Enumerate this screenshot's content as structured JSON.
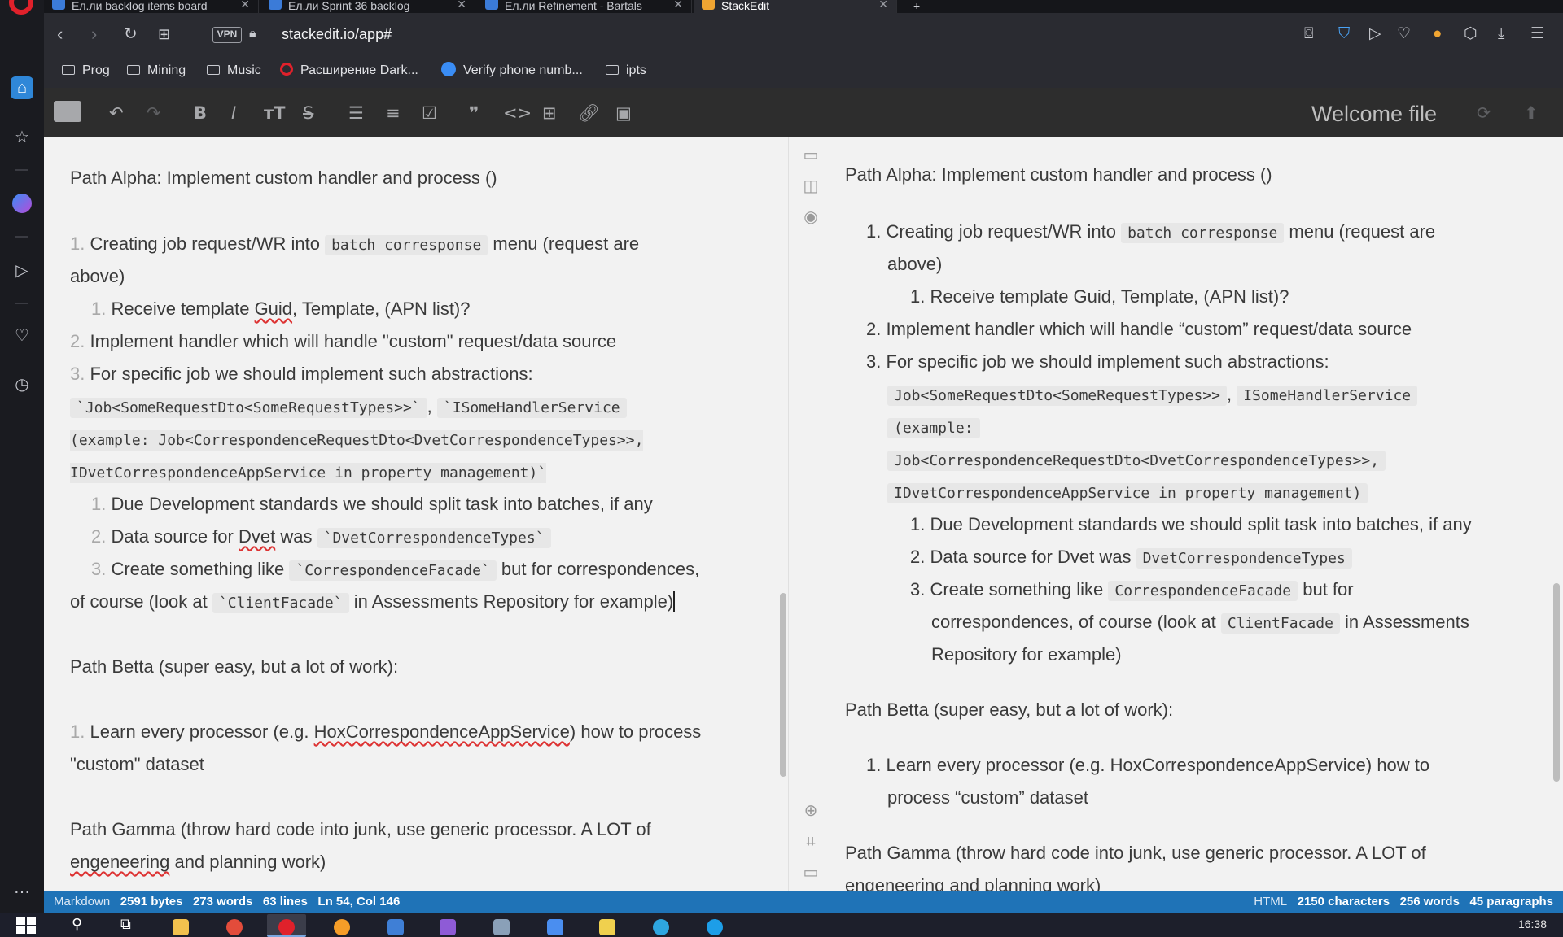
{
  "browser": {
    "tabs": [
      {
        "label": "Ел.ли backlog items board",
        "active": false
      },
      {
        "label": "Ел.ли Sprint 36 backlog",
        "active": false
      },
      {
        "label": "Ел.ли Refinement - Bartals",
        "active": false
      },
      {
        "label": "StackEdit",
        "active": true
      }
    ],
    "vpn_label": "VPN",
    "url": "stackedit.io/app#",
    "bookmarks": [
      "Prog",
      "Mining",
      "Music",
      "Расширение Dark...",
      "Verify phone numb...",
      "ipts"
    ]
  },
  "stackedit": {
    "file_title": "Welcome file",
    "workspace_button": "#"
  },
  "editor": {
    "l1": "Path Alpha: Implement custom handler and process ()",
    "l2_num": "1.",
    "l2_a": " Creating job request/WR into ",
    "l2_code": "batch corresponse",
    "l2_b": " menu (request are",
    "l3": "above)",
    "l4_num": "1.",
    "l4_a": " Receive template ",
    "l4_guid": "Guid",
    "l4_b": ", Template, (APN list)?",
    "l5_num": "2.",
    "l5": " Implement handler which will handle \"custom\" request/data source",
    "l6_num": "3.",
    "l6": " For specific job we should implement such abstractions:",
    "l7_code1": "`Job<SomeRequestDto<SomeRequestTypes>>`",
    "l7_sep": ",",
    "l7_code2": "`ISomeHandlerService",
    "l8_code": "(example: Job<CorrespondenceRequestDto<DvetCorrespondenceTypes>>,",
    "l9_code": "IDvetCorrespondenceAppService in property management)`",
    "l10_num": "1.",
    "l10": " Due Development standards we should split task into batches, if any",
    "l11_num": "2.",
    "l11_a": " Data source for ",
    "l11_dvet": "Dvet",
    "l11_b": " was ",
    "l11_code": "`DvetCorrespondenceTypes`",
    "l12_num": "3.",
    "l12_a": " Create something like ",
    "l12_code": "`CorrespondenceFacade`",
    "l12_b": " but for correspondences,",
    "l13_a": "of course (look at ",
    "l13_code": "`ClientFacade`",
    "l13_b": " in Assessments Repository for example)",
    "l14": "Path Betta (super easy, but a lot of work):",
    "l15_num": "1.",
    "l15_a": " Learn every processor (e.g. ",
    "l15_hox": "HoxCorrespondenceAppService",
    "l15_b": ") how to process",
    "l16": "\"custom\" dataset",
    "l17": "Path Gamma (throw hard code into junk, use generic processor. A LOT of",
    "l18_eng": "engeneering",
    "l18_b": " and planning work)"
  },
  "preview": {
    "p1": "Path Alpha: Implement custom handler and process ()",
    "p2_num": "1.",
    "p2_a": " Creating job request/WR into ",
    "p2_code": "batch corresponse",
    "p2_b": " menu (request are",
    "p3": "above)",
    "p4_num": "1.",
    "p4": " Receive template Guid, Template, (APN list)?",
    "p5_num": "2.",
    "p5": " Implement handler which will handle “custom” request/data source",
    "p6_num": "3.",
    "p6": " For specific job we should implement such abstractions:",
    "p7_code1": "Job<SomeRequestDto<SomeRequestTypes>>",
    "p7_sep": ",",
    "p7_code2": "ISomeHandlerService",
    "p8_code": "(example:",
    "p9_code": "Job<CorrespondenceRequestDto<DvetCorrespondenceTypes>>,",
    "p10_code": "IDvetCorrespondenceAppService in property management)",
    "p11_num": "1.",
    "p11": " Due Development standards we should split task into batches, if any",
    "p12_num": "2.",
    "p12_a": " Data source for Dvet was ",
    "p12_code": "DvetCorrespondenceTypes",
    "p13_num": "3.",
    "p13_a": " Create something like ",
    "p13_code": "CorrespondenceFacade",
    "p13_b": " but for",
    "p14_a": "correspondences, of course (look at ",
    "p14_code": "ClientFacade",
    "p14_b": " in Assessments",
    "p15": "Repository for example)",
    "p16": "Path Betta (super easy, but a lot of work):",
    "p17_num": "1.",
    "p17": " Learn every processor (e.g. HoxCorrespondenceAppService) how to",
    "p18": "process “custom” dataset",
    "p19": "Path Gamma (throw hard code into junk, use generic processor. A LOT of",
    "p20": "engeneering and planning work)"
  },
  "status": {
    "left_mode": "Markdown",
    "bytes": "2591 bytes",
    "words": "273 words",
    "lines": "63 lines",
    "position": "Ln 54, Col 146",
    "right_mode": "HTML",
    "characters": "2150 characters",
    "pwords": "256 words",
    "paragraphs": "45 paragraphs"
  },
  "taskbar": {
    "clock": "16:38"
  },
  "colors": {
    "status_bar": "#1f73b7",
    "accent": "#e8a53c",
    "opera_red": "#e0212b"
  }
}
